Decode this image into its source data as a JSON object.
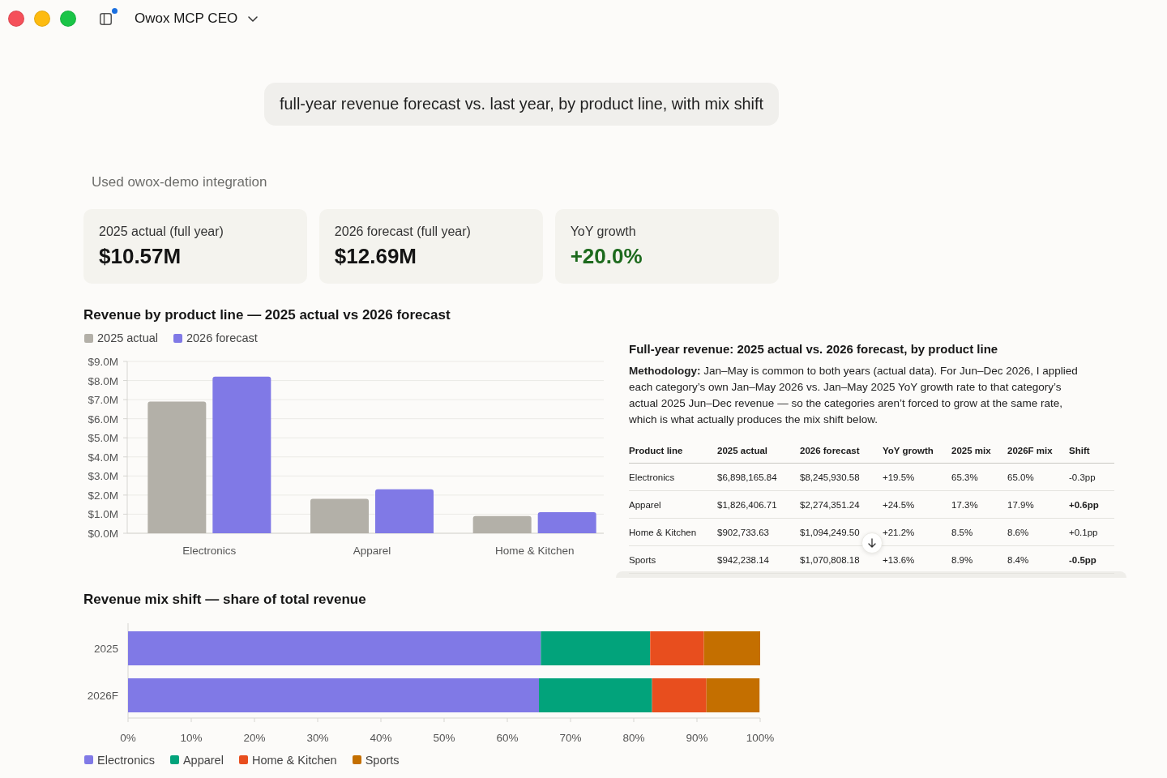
{
  "window": {
    "title": "Owox MCP CEO",
    "sidebar_badge": true
  },
  "user_message": "full-year revenue forecast vs. last year, by product line, with mix shift",
  "integration_note": "Used owox-demo integration",
  "kpis": [
    {
      "label": "2025 actual (full year)",
      "value": "$10.57M",
      "positive": false
    },
    {
      "label": "2026 forecast (full year)",
      "value": "$12.69M",
      "positive": false
    },
    {
      "label": "YoY growth",
      "value": "+20.0%",
      "positive": true
    }
  ],
  "revenue_chart": {
    "chart_data": {
      "type": "bar",
      "title": "Revenue by product line — 2025 actual vs 2026 forecast",
      "legend": "top",
      "grid": true,
      "categories": [
        "Electronics",
        "Apparel",
        "Home & Kitchen"
      ],
      "ylim": [
        0,
        9
      ],
      "yticks": [
        {
          "value": 0,
          "label": "$0.0M"
        },
        {
          "value": 1,
          "label": "$1.0M"
        },
        {
          "value": 2,
          "label": "$2.0M"
        },
        {
          "value": 3,
          "label": "$3.0M"
        },
        {
          "value": 4,
          "label": "$4.0M"
        },
        {
          "value": 5,
          "label": "$5.0M"
        },
        {
          "value": 6,
          "label": "$6.0M"
        },
        {
          "value": 7,
          "label": "$7.0M"
        },
        {
          "value": 8,
          "label": "$8.0M"
        },
        {
          "value": 9,
          "label": "$9.0M"
        }
      ],
      "series": [
        {
          "name": "2025 actual",
          "color": "#b3b0a8",
          "values": [
            6.9,
            1.8,
            0.9
          ]
        },
        {
          "name": "2026 forecast",
          "color": "#8079e6",
          "values": [
            8.2,
            2.3,
            1.1
          ]
        }
      ]
    }
  },
  "summary": {
    "title": "Full-year revenue: 2025 actual vs. 2026 forecast, by product line",
    "methodology": "**Methodology:** Jan–May is common to both years (actual data). For Jun–Dec 2026, I applied each category’s own Jan–May 2026 vs. Jan–May 2025 YoY growth rate to that category’s actual 2025 Jun–Dec revenue — so the categories aren’t forced to grow at the same rate, which is what actually produces the mix shift below.",
    "table": {
      "columns": [
        "Product line",
        "2025 actual",
        "2026 forecast",
        "YoY growth",
        "2025 mix",
        "2026F mix",
        "Shift"
      ],
      "rows": [
        {
          "cells": [
            "Electronics",
            "$6,898,165.84",
            "$8,245,930.58",
            "+19.5%",
            "65.3%",
            "65.0%",
            "-0.3pp"
          ],
          "shift_emphasized": false
        },
        {
          "cells": [
            "Apparel",
            "$1,826,406.71",
            "$2,274,351.24",
            "+24.5%",
            "17.3%",
            "17.9%",
            "+0.6pp"
          ],
          "shift_emphasized": true
        },
        {
          "cells": [
            "Home & Kitchen",
            "$902,733.63",
            "$1,094,249.50",
            "+21.2%",
            "8.5%",
            "8.6%",
            "+0.1pp"
          ],
          "shift_emphasized": false
        },
        {
          "cells": [
            "Sports",
            "$942,238.14",
            "$1,070,808.18",
            "+13.6%",
            "8.9%",
            "8.4%",
            "-0.5pp"
          ],
          "shift_emphasized": true
        }
      ]
    }
  },
  "mix_chart": {
    "chart_data": {
      "type": "bar",
      "orientation": "horizontal",
      "stacked": true,
      "title": "Revenue mix shift — share of total revenue",
      "legend": "bottom",
      "categories": [
        "2025",
        "2026F"
      ],
      "xlim": [
        0,
        100
      ],
      "xticks": [
        {
          "value": 0,
          "label": "0%"
        },
        {
          "value": 10,
          "label": "10%"
        },
        {
          "value": 20,
          "label": "20%"
        },
        {
          "value": 30,
          "label": "30%"
        },
        {
          "value": 40,
          "label": "40%"
        },
        {
          "value": 50,
          "label": "50%"
        },
        {
          "value": 60,
          "label": "60%"
        },
        {
          "value": 70,
          "label": "70%"
        },
        {
          "value": 80,
          "label": "80%"
        },
        {
          "value": 90,
          "label": "90%"
        },
        {
          "value": 100,
          "label": "100%"
        }
      ],
      "series": [
        {
          "name": "Electronics",
          "color": "#8079e6",
          "values": [
            65.3,
            65.0
          ]
        },
        {
          "name": "Apparel",
          "color": "#02a37b",
          "values": [
            17.3,
            17.9
          ]
        },
        {
          "name": "Home & Kitchen",
          "color": "#e84e1e",
          "values": [
            8.5,
            8.6
          ]
        },
        {
          "name": "Sports",
          "color": "#c46f00",
          "values": [
            8.9,
            8.4
          ]
        }
      ]
    }
  }
}
